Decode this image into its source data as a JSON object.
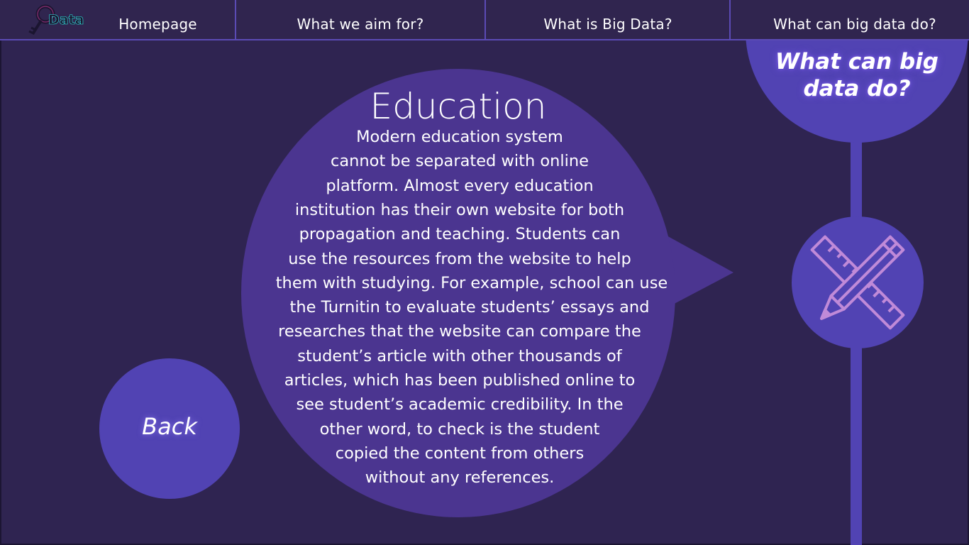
{
  "nav": {
    "logo_text": "Data",
    "items": [
      {
        "label": "Homepage"
      },
      {
        "label": "What we aim for?"
      },
      {
        "label": "What is Big Data?"
      },
      {
        "label": "What can big data do?"
      }
    ]
  },
  "section_badge": {
    "line1": "What can big",
    "line2": "data do?"
  },
  "topic_icon": "pencil-ruler-icon",
  "article": {
    "title": "Education",
    "lines": [
      "Modern education system",
      "cannot be separated with online",
      "platform. Almost every education",
      "institution has their own website for both",
      "propagation and teaching. Students can",
      "use the resources from the website to help",
      "them with studying. For example, school can use",
      "the Turnitin to evaluate students’ essays and",
      "researches that the website can compare the",
      "student’s article with other thousands of",
      "articles, which has been published online to",
      "see student’s academic credibility. In the",
      "other word, to check is the student",
      "copied the content from others",
      "without any references."
    ]
  },
  "back_button": {
    "label": "Back"
  },
  "colors": {
    "background": "#2f2451",
    "accent": "#5143b3",
    "bubble": "#4b3590",
    "icon_stroke": "#c08ad8"
  }
}
